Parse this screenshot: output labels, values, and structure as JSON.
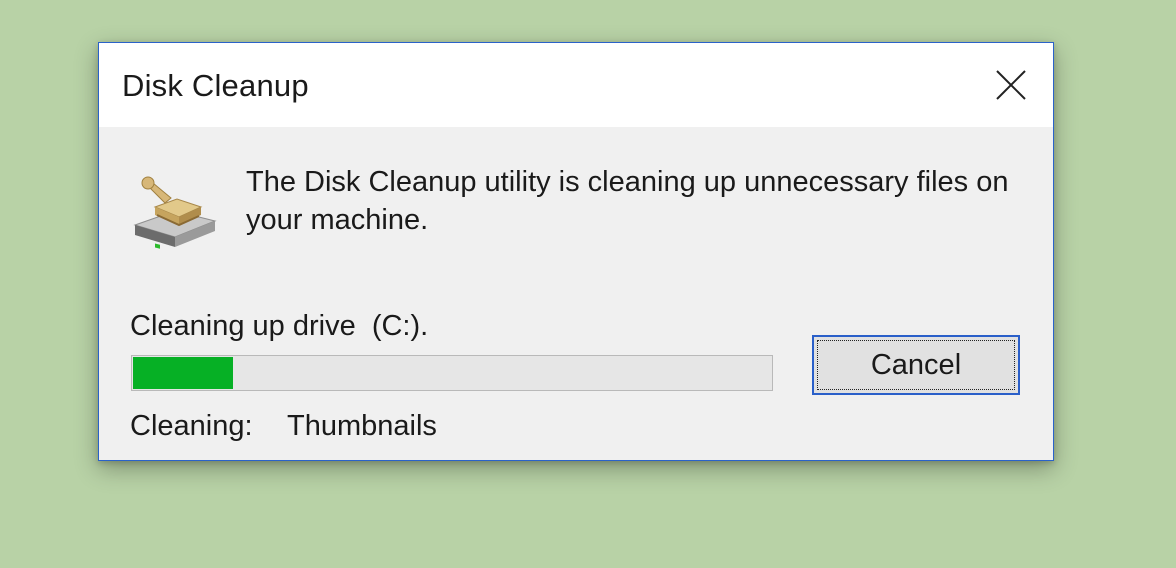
{
  "window": {
    "title": "Disk Cleanup",
    "close_icon": "close-icon"
  },
  "content": {
    "icon": "disk-cleanup-icon",
    "message": "The Disk Cleanup utility is cleaning up unnecessary files on your machine.",
    "drive_label": "Cleaning up drive  (C:).",
    "progress_percent": 16,
    "status_label": "Cleaning:",
    "status_value": "Thumbnails"
  },
  "buttons": {
    "cancel_label": "Cancel"
  },
  "colors": {
    "background": "#b8d2a6",
    "progress_fill": "#06b025",
    "accent_border": "#2a62c9"
  }
}
